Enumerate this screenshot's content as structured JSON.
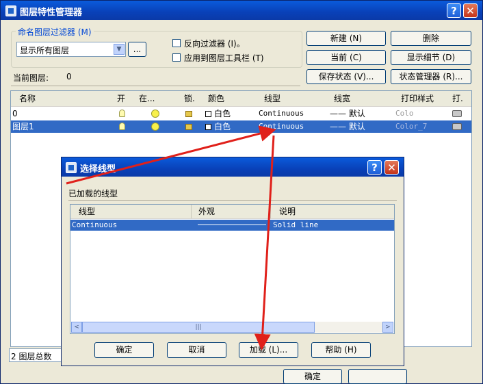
{
  "main_window": {
    "title": "图层特性管理器",
    "help": "?",
    "close": "✕",
    "filter_group_label": "命名图层过滤器 (M)",
    "filter_select_value": "显示所有图层",
    "filter_browse_button": "...",
    "invert_filter_label": "反向过滤器 (I)。",
    "apply_toolbar_label": "应用到图层工具栏 (T)",
    "buttons": {
      "new": "新建 (N)",
      "delete": "删除",
      "current": "当前 (C)",
      "show_details": "显示细节 (D)",
      "save_state": "保存状态 (V)...",
      "state_manager": "状态管理器 (R)..."
    },
    "current_layer_label": "当前图层:",
    "current_layer_value": "0",
    "columns": {
      "name": "名称",
      "on": "开",
      "freeze": "在...",
      "lock": "锁.",
      "color": "颜色",
      "linetype": "线型",
      "lineweight": "线宽",
      "plot_style": "打印样式",
      "plot": "打."
    },
    "layers": [
      {
        "name": "0",
        "color": "白色",
        "linetype": "Continuous",
        "lineweight": "—— 默认",
        "plot_style": "Colo"
      },
      {
        "name": "图层1",
        "color": "白色",
        "linetype": "Continuous",
        "lineweight": "—— 默认",
        "plot_style": "Color_7"
      }
    ],
    "status_text": "2 图层总数",
    "ok_button": "确定"
  },
  "dialog": {
    "title": "选择线型",
    "help": "?",
    "close": "✕",
    "loaded_label": "已加载的线型",
    "columns": {
      "linetype": "线型",
      "appearance": "外观",
      "description": "说明"
    },
    "rows": [
      {
        "linetype": "Continuous",
        "description": "Solid line"
      }
    ],
    "scroll_left": "<",
    "scroll_right": ">",
    "scroll_thumb": "|||",
    "buttons": {
      "ok": "确定",
      "cancel": "取消",
      "load": "加载 (L)...",
      "help": "帮助 (H)"
    }
  },
  "colors": {
    "titlebar": "#0a5bdb",
    "selection": "#316ac5",
    "window_bg": "#ece9d8",
    "annotation_arrow": "#e0201a"
  },
  "icons": [
    "app-icon",
    "help-icon",
    "close-icon",
    "bulb-icon",
    "sun-icon",
    "lock-icon",
    "printer-icon",
    "dropdown-arrow-icon"
  ]
}
